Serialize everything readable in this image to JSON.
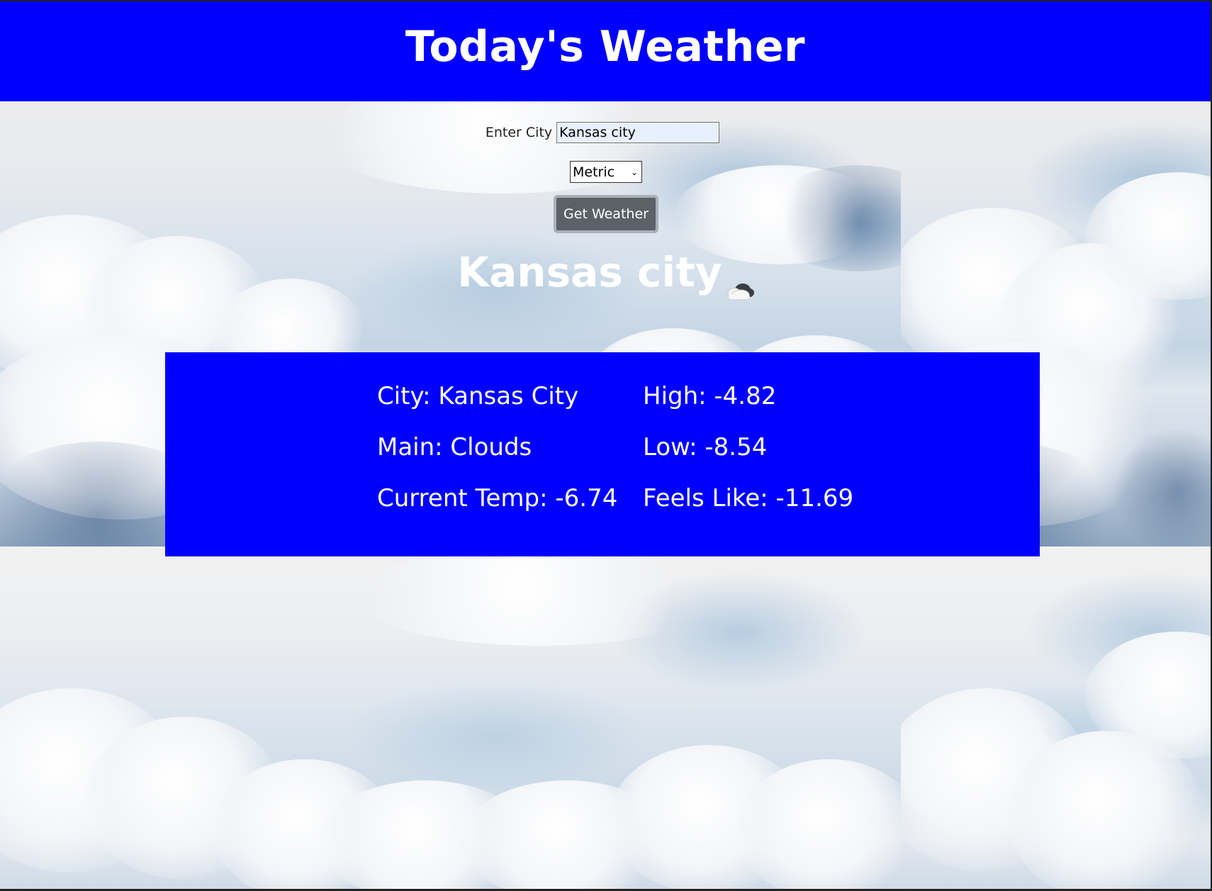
{
  "header": {
    "title": "Today's Weather"
  },
  "form": {
    "city_label": "Enter City",
    "city_value": "Kansas city",
    "units_selected": "Metric",
    "submit_label": "Get Weather"
  },
  "result": {
    "heading": "Kansas city",
    "icon": "cloud-icon",
    "rows": [
      {
        "left": "City: Kansas City",
        "right": "High: -4.82"
      },
      {
        "left": "Main: Clouds",
        "right": "Low: -8.54"
      },
      {
        "left": "Current Temp: -6.74",
        "right": "Feels Like: -11.69"
      }
    ]
  },
  "colors": {
    "header_bg": "#0000ff",
    "panel_bg": "#0000ff",
    "button_bg": "#5a6268"
  }
}
